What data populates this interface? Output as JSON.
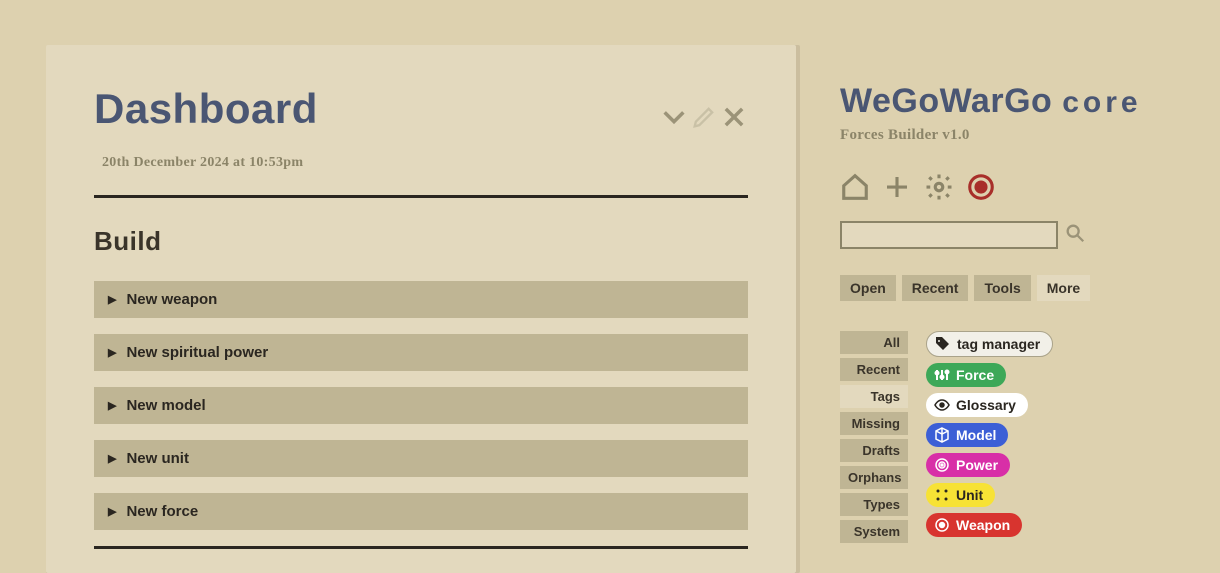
{
  "main": {
    "title": "Dashboard",
    "date": "20th December 2024 at 10:53pm",
    "build_heading": "Build",
    "build_items": [
      "New weapon",
      "New spiritual power",
      "New model",
      "New unit",
      "New force"
    ]
  },
  "sidebar": {
    "brand_main": "WeGoWarGo",
    "brand_sub": "core",
    "subtitle": "Forces Builder v1.0",
    "search_placeholder": "",
    "tabs": [
      "Open",
      "Recent",
      "Tools",
      "More"
    ],
    "active_tab": 3,
    "filters": [
      "All",
      "Recent",
      "Tags",
      "Missing",
      "Drafts",
      "Orphans",
      "Types",
      "System"
    ],
    "active_filter": 2,
    "tags": [
      {
        "label": "tag manager",
        "style": "pill-white",
        "icon": "tag-icon"
      },
      {
        "label": "Force",
        "style": "pill-green",
        "icon": "sliders-icon"
      },
      {
        "label": "Glossary",
        "style": "pill-white2",
        "icon": "eye-icon"
      },
      {
        "label": "Model",
        "style": "pill-blue",
        "icon": "cube-icon"
      },
      {
        "label": "Power",
        "style": "pill-magenta",
        "icon": "spiral-icon"
      },
      {
        "label": "Unit",
        "style": "pill-yellow",
        "icon": "grid-icon"
      },
      {
        "label": "Weapon",
        "style": "pill-red",
        "icon": "target-icon"
      }
    ]
  }
}
